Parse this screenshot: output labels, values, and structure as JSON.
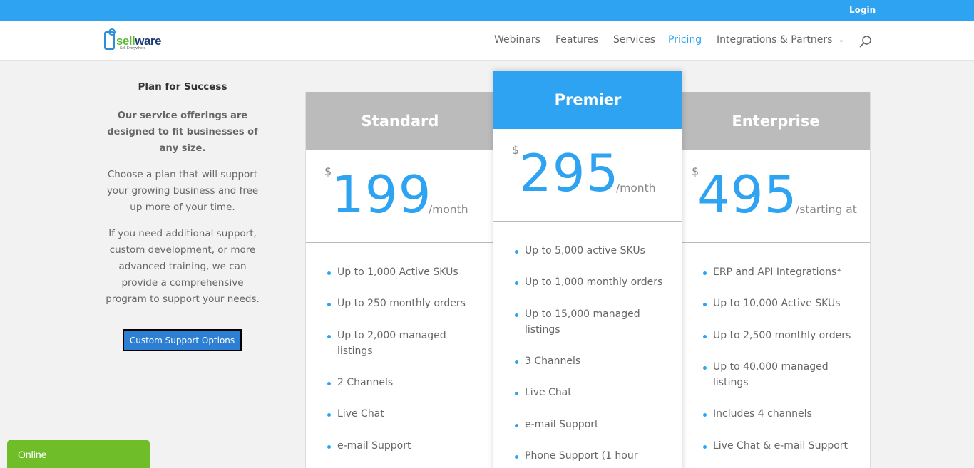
{
  "topbar": {
    "login_label": "Login"
  },
  "logo": {
    "sell": "sell",
    "ware": "ware",
    "tagline": "Sell Everywhere"
  },
  "nav": {
    "items": [
      {
        "label": "Webinars"
      },
      {
        "label": "Features"
      },
      {
        "label": "Services"
      },
      {
        "label": "Pricing",
        "active": true
      },
      {
        "label": "Integrations & Partners",
        "has_dropdown": true
      }
    ],
    "search_icon": "search-icon"
  },
  "sidebar": {
    "title": "Plan for Success",
    "lead": "Our service offerings are designed to fit businesses of any size.",
    "paragraph1": "Choose a plan that will support your growing business and free up more of your time.",
    "paragraph2": "If you need additional support, custom development, or more advanced training, we can provide a comprehensive program to support your needs.",
    "button_label": "Custom Support Options"
  },
  "plans": [
    {
      "name": "Standard",
      "currency": "$",
      "price": "199",
      "frequency": "/month",
      "features": [
        "Up to 1,000 Active SKUs",
        "Up to 250 monthly orders",
        "Up to 2,000 managed listings",
        "2 Channels",
        "Live Chat",
        "e-mail Support"
      ]
    },
    {
      "name": "Premier",
      "featured": true,
      "currency": "$",
      "price": "295",
      "frequency": "/month",
      "features": [
        "Up to 5,000 active SKUs",
        "Up to 1,000 monthly orders",
        "Up to 15,000 managed listings",
        "3 Channels",
        "Live Chat",
        "e-mail Support",
        "Phone Support (1 hour"
      ]
    },
    {
      "name": "Enterprise",
      "currency": "$",
      "price": "495",
      "frequency": "/starting at",
      "features": [
        "ERP and API Integrations*",
        "Up to 10,000 Active SKUs",
        "Up to 2,500 monthly orders",
        "Up to 40,000 managed listings",
        "Includes 4 channels",
        "Live Chat & e-mail Support"
      ]
    }
  ],
  "chat_widget": {
    "status": "Online"
  },
  "colors": {
    "accent": "#2ea3f2",
    "header_gray": "#bbbbbb",
    "online_green": "#70bd2a",
    "button_blue": "#2c7fd2"
  }
}
